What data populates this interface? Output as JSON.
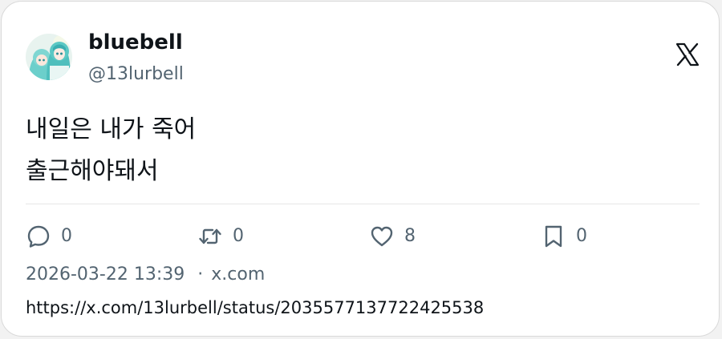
{
  "author": {
    "display_name": "bluebell",
    "handle": "@13lurbell",
    "avatar": "anime-character-avatar"
  },
  "brand": {
    "logo": "x-logo-icon"
  },
  "tweet": {
    "lines": [
      "내일은 내가 죽어",
      "출근해야돼서"
    ]
  },
  "actions": {
    "reply": {
      "icon": "reply-icon",
      "count": "0"
    },
    "retweet": {
      "icon": "retweet-icon",
      "count": "0"
    },
    "like": {
      "icon": "heart-icon",
      "count": "8"
    },
    "bookmark": {
      "icon": "bookmark-icon",
      "count": "0"
    }
  },
  "meta": {
    "timestamp": "2026-03-22 13:39",
    "separator": "·",
    "source": "x.com"
  },
  "url": "https://x.com/13lurbell/status/2035577137722425538",
  "colors": {
    "text_primary": "#0f1419",
    "text_secondary": "#536471",
    "border": "#d9d9d9",
    "divider": "#e6e6e6",
    "avatar_accent": "#5cc8c4"
  }
}
